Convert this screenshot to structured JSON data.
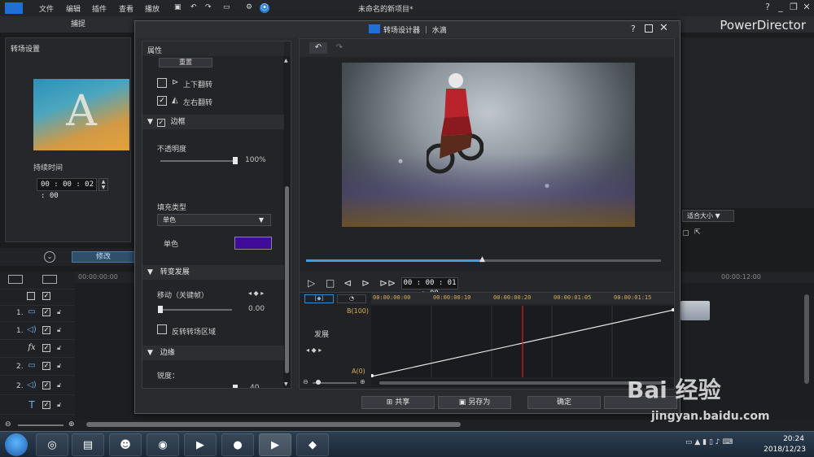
{
  "menubar": {
    "items": [
      "文件",
      "编辑",
      "插件",
      "查看",
      "播放"
    ],
    "title": "未命名的新项目*",
    "help": "?"
  },
  "tabs": {
    "capture": "捕捉"
  },
  "brand": "PowerDirector",
  "left_panel": {
    "title": "转场设置",
    "thumb_letter": "A",
    "duration_label": "持续时间",
    "duration_value": "00 : 00 : 02 : 00"
  },
  "timeline": {
    "modify_label": "修改",
    "ruler_start": "00:00:00:00",
    "ruler_right": "00:00:12:00",
    "tracks": [
      {
        "num": "1.",
        "icon": "video-track-icon",
        "glyph": "▭"
      },
      {
        "num": "1.",
        "icon": "audio-track-icon",
        "glyph": "◁)"
      },
      {
        "num": "",
        "icon": "fx-track-icon",
        "glyph": "fx"
      },
      {
        "num": "2.",
        "icon": "video-track-icon",
        "glyph": "▭"
      },
      {
        "num": "2.",
        "icon": "audio-track-icon",
        "glyph": "◁)"
      },
      {
        "num": "",
        "icon": "title-track-icon",
        "glyph": "T"
      }
    ],
    "fit_select": "适合大小"
  },
  "dialog": {
    "title": "转场设计器 ｜ 水滴",
    "help": "?",
    "properties": {
      "header": "属性",
      "reset_label": "重置",
      "flip_vertical": "上下翻转",
      "flip_horizontal": "左右翻转",
      "border_section": "边框",
      "opacity_label": "不透明度",
      "opacity_value": "100%",
      "opacity_level": 1.0,
      "fill_type_label": "填充类型",
      "fill_type_value": "单色",
      "solid_label": "单色",
      "solid_color": "#3e0c99",
      "gradient_section": "转变发展",
      "move_label": "移动（关键帧）",
      "move_value": "0.00",
      "move_level": 0.0,
      "invert_label": "反转转场区域",
      "edge_section": "边缘",
      "sharpness_label": "锐度：",
      "sharpness_value": "40",
      "sharpness_level": 1.0
    },
    "preview": {
      "seek_level": 0.5,
      "timecode": "00 : 00 : 01 : 00"
    },
    "keyframe": {
      "mode1": "[◆]",
      "mode2": "◔",
      "track_label": "发展",
      "b_label": "B(100)",
      "a_label": "A(0)",
      "ticks": [
        "00:00:00:00",
        "00:00:00:10",
        "00:00:00:20",
        "00:00:01:05",
        "00:00:01:15"
      ],
      "playhead_level": 0.5
    },
    "buttons": {
      "share": "共享",
      "save_as": "另存为",
      "ok": "确定"
    }
  },
  "taskbar": {
    "time": "20:24",
    "date": "2018/12/23"
  },
  "watermark": {
    "logo_text": "Bai 经验",
    "url": "jingyan.baidu.com"
  }
}
